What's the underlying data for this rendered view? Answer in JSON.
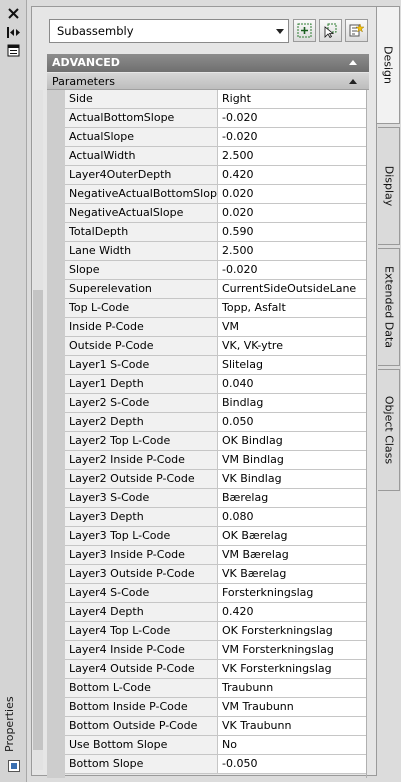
{
  "palette": {
    "title": "Properties"
  },
  "toolbar": {
    "object_type": "Subassembly",
    "buttons": [
      {
        "name": "toggle-pickadd-icon"
      },
      {
        "name": "select-objects-icon"
      },
      {
        "name": "quick-select-icon"
      }
    ]
  },
  "sections": {
    "advanced": "ADVANCED",
    "parameters": "Parameters"
  },
  "properties": [
    {
      "name": "Side",
      "value": "Right"
    },
    {
      "name": "ActualBottomSlope",
      "value": "-0.020"
    },
    {
      "name": "ActualSlope",
      "value": "-0.020"
    },
    {
      "name": "ActualWidth",
      "value": "2.500"
    },
    {
      "name": "Layer4OuterDepth",
      "value": "0.420"
    },
    {
      "name": "NegativeActualBottomSlope",
      "value": "0.020"
    },
    {
      "name": "NegativeActualSlope",
      "value": "0.020"
    },
    {
      "name": "TotalDepth",
      "value": "0.590"
    },
    {
      "name": "Lane Width",
      "value": "2.500"
    },
    {
      "name": "Slope",
      "value": "-0.020"
    },
    {
      "name": "Superelevation",
      "value": "CurrentSideOutsideLane"
    },
    {
      "name": "Top L-Code",
      "value": "Topp, Asfalt"
    },
    {
      "name": "Inside P-Code",
      "value": "VM"
    },
    {
      "name": "Outside P-Code",
      "value": "VK, VK-ytre"
    },
    {
      "name": "Layer1 S-Code",
      "value": "Slitelag"
    },
    {
      "name": "Layer1 Depth",
      "value": "0.040"
    },
    {
      "name": "Layer2 S-Code",
      "value": "Bindlag"
    },
    {
      "name": "Layer2 Depth",
      "value": "0.050"
    },
    {
      "name": "Layer2 Top L-Code",
      "value": "OK Bindlag"
    },
    {
      "name": "Layer2 Inside P-Code",
      "value": "VM Bindlag"
    },
    {
      "name": "Layer2 Outside P-Code",
      "value": "VK Bindlag"
    },
    {
      "name": "Layer3 S-Code",
      "value": "Bærelag"
    },
    {
      "name": "Layer3 Depth",
      "value": "0.080"
    },
    {
      "name": "Layer3 Top L-Code",
      "value": "OK Bærelag"
    },
    {
      "name": "Layer3 Inside P-Code",
      "value": "VM Bærelag"
    },
    {
      "name": "Layer3 Outside P-Code",
      "value": "VK Bærelag"
    },
    {
      "name": "Layer4 S-Code",
      "value": "Forsterkningslag"
    },
    {
      "name": "Layer4 Depth",
      "value": "0.420"
    },
    {
      "name": "Layer4 Top L-Code",
      "value": "OK Forsterkningslag"
    },
    {
      "name": "Layer4 Inside P-Code",
      "value": "VM Forsterkningslag"
    },
    {
      "name": "Layer4 Outside P-Code",
      "value": "VK Forsterkningslag"
    },
    {
      "name": "Bottom L-Code",
      "value": "Traubunn"
    },
    {
      "name": "Bottom Inside P-Code",
      "value": "VM Traubunn"
    },
    {
      "name": "Bottom Outside P-Code",
      "value": "VK Traubunn"
    },
    {
      "name": "Use Bottom Slope",
      "value": "No"
    },
    {
      "name": "Bottom Slope",
      "value": "-0.050"
    }
  ],
  "tabs": [
    {
      "label": "Design",
      "active": true
    },
    {
      "label": "Display",
      "active": false
    },
    {
      "label": "Extended Data",
      "active": false
    },
    {
      "label": "Object Class",
      "active": false
    }
  ],
  "strip_icons": [
    "close-icon",
    "auto-hide-icon",
    "properties-menu-icon"
  ]
}
